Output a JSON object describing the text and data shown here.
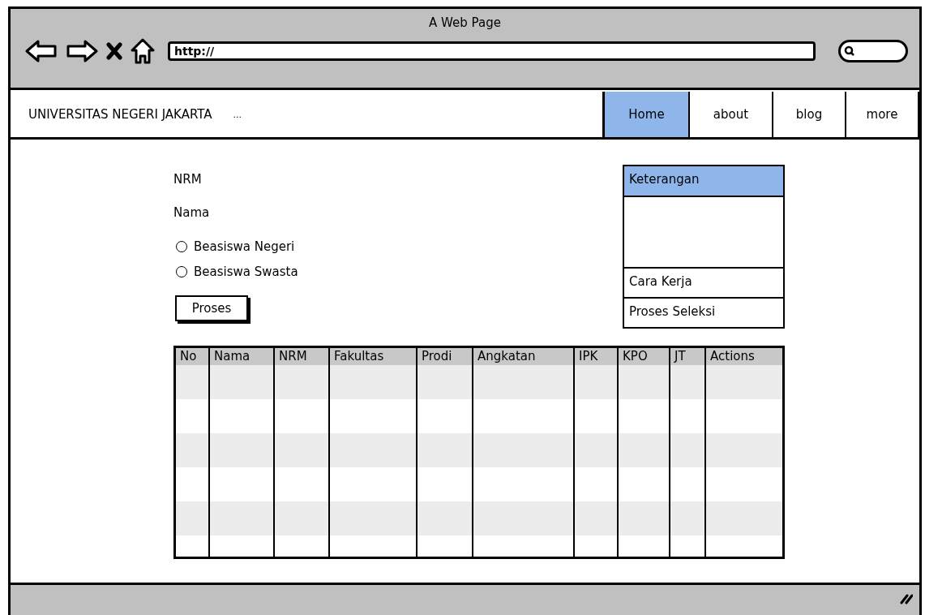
{
  "window": {
    "title": "A Web Page",
    "address": "http://"
  },
  "nav": {
    "brand": "UNIVERSITAS NEGERI JAKARTA",
    "ellipsis": "...",
    "tabs": [
      {
        "label": "Home",
        "selected": true
      },
      {
        "label": "about",
        "selected": false
      },
      {
        "label": "blog",
        "selected": false
      },
      {
        "label": "more",
        "selected": false
      }
    ]
  },
  "form": {
    "fields": [
      {
        "label": "NRM"
      },
      {
        "label": "Nama"
      }
    ],
    "radios": [
      {
        "label": "Beasiswa Negeri",
        "selected": false
      },
      {
        "label": "Beasiswa Swasta",
        "selected": false
      }
    ],
    "button": "Proses"
  },
  "side_panel": {
    "items": [
      {
        "label": "Keterangan",
        "selected": true
      },
      {
        "label": "Cara Kerja",
        "selected": false
      },
      {
        "label": "Proses Seleksi",
        "selected": false
      }
    ]
  },
  "table": {
    "columns": [
      "No",
      "Nama",
      "NRM",
      "Fakultas",
      "Prodi",
      "Angkatan",
      "IPK",
      "KPO",
      "JT",
      "Actions"
    ]
  }
}
